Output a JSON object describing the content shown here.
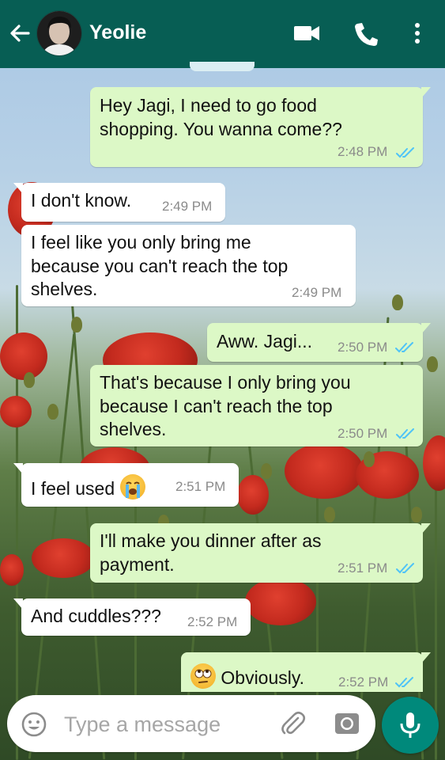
{
  "header": {
    "contact_name": "Yeolie",
    "bg_color": "#075e54",
    "icons": [
      "back-arrow-icon",
      "video-call-icon",
      "phone-call-icon",
      "more-options-icon"
    ]
  },
  "messages": [
    {
      "dir": "out",
      "lines": [
        "Hey Jagi, I need to go food",
        "shopping. You wanna come??"
      ],
      "time": "2:48 PM",
      "read": true
    },
    {
      "dir": "in",
      "lines": [
        "I don't know."
      ],
      "time": "2:49 PM"
    },
    {
      "dir": "in",
      "lines": [
        "I feel like you only bring me",
        "because you can't reach the top",
        "shelves."
      ],
      "time": "2:49 PM"
    },
    {
      "dir": "out",
      "lines": [
        "Aww. Jagi..."
      ],
      "time": "2:50 PM",
      "read": true
    },
    {
      "dir": "out",
      "lines": [
        "That's because I only bring you",
        "because I can't reach the top",
        "shelves."
      ],
      "time": "2:50 PM",
      "read": true
    },
    {
      "dir": "in",
      "lines": [
        "I feel used"
      ],
      "emoji": "loudly-crying-face-emoji",
      "time": "2:51 PM"
    },
    {
      "dir": "out",
      "lines": [
        "I'll make you dinner after as",
        "payment."
      ],
      "time": "2:51 PM",
      "read": true
    },
    {
      "dir": "in",
      "lines": [
        "And cuddles???"
      ],
      "time": "2:52 PM"
    },
    {
      "dir": "out",
      "lines": [
        "Obviously."
      ],
      "emoji": "face-with-rolling-eyes-emoji",
      "time": "2:52 PM",
      "read": true
    }
  ],
  "composer": {
    "placeholder": "Type a message",
    "icons": [
      "emoji-icon",
      "attach-icon",
      "camera-icon",
      "microphone-icon"
    ]
  },
  "colors": {
    "outgoing_bubble": "#dcf8c6",
    "incoming_bubble": "#ffffff",
    "read_ticks": "#4fc3f7",
    "mic_button": "#00897b"
  }
}
